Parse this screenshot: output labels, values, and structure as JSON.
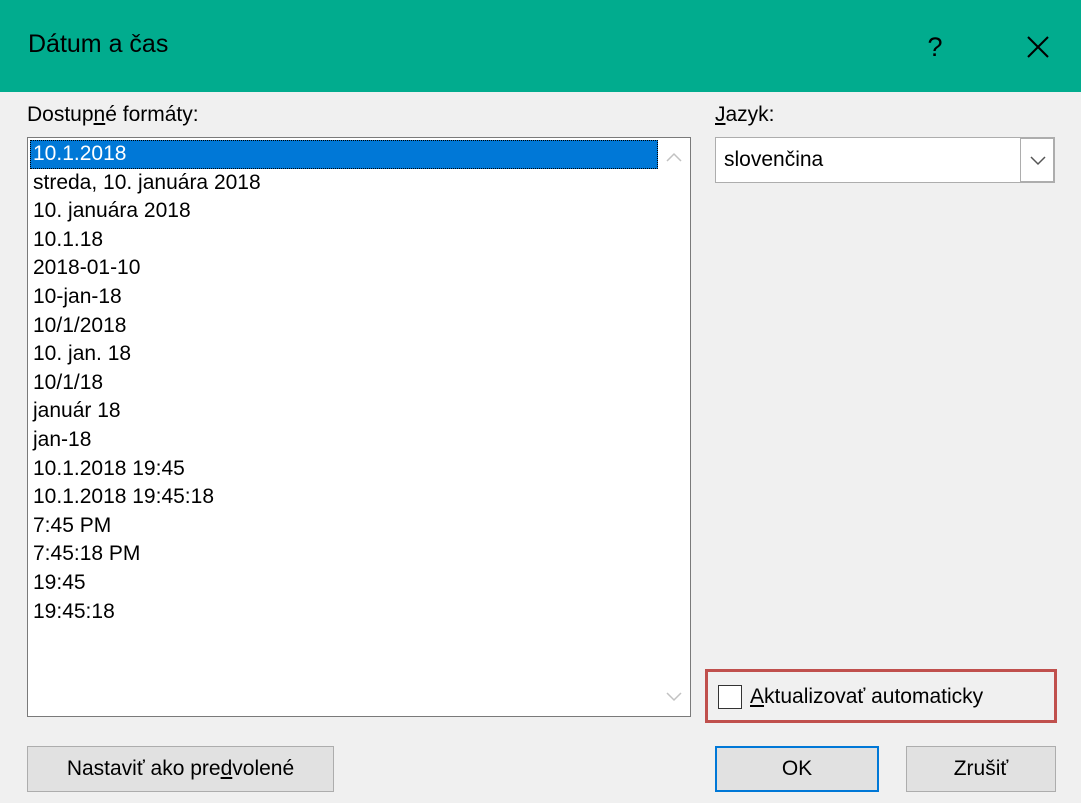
{
  "window": {
    "title": "Dátum a čas",
    "help_label": "?",
    "close_icon": "close-icon"
  },
  "formats": {
    "label_pre": "Dostup",
    "label_accel": "n",
    "label_post": "é formáty:",
    "items": [
      "10.1.2018",
      "streda, 10. januára 2018",
      "10. januára 2018",
      "10.1.18",
      "2018-01-10",
      "10-jan-18",
      "10/1/2018",
      "10. jan. 18",
      "10/1/18",
      "január 18",
      "jan-18",
      "10.1.2018 19:45",
      "10.1.2018 19:45:18",
      "7:45 PM",
      "7:45:18 PM",
      "19:45",
      "19:45:18"
    ],
    "selected": "10.1.2018"
  },
  "language": {
    "label_accel": "J",
    "label_post": "azyk:",
    "value": "slovenčina"
  },
  "auto_update": {
    "label_accel": "A",
    "label_post": "ktualizovať automaticky",
    "checked": false
  },
  "buttons": {
    "set_default_pre": "Nastaviť ako pre",
    "set_default_accel": "d",
    "set_default_post": "volené",
    "ok": "OK",
    "cancel": "Zrušiť"
  },
  "colors": {
    "titlebar": "#01ac8e",
    "selection": "#0078d7",
    "highlight_border": "#c0504d"
  }
}
